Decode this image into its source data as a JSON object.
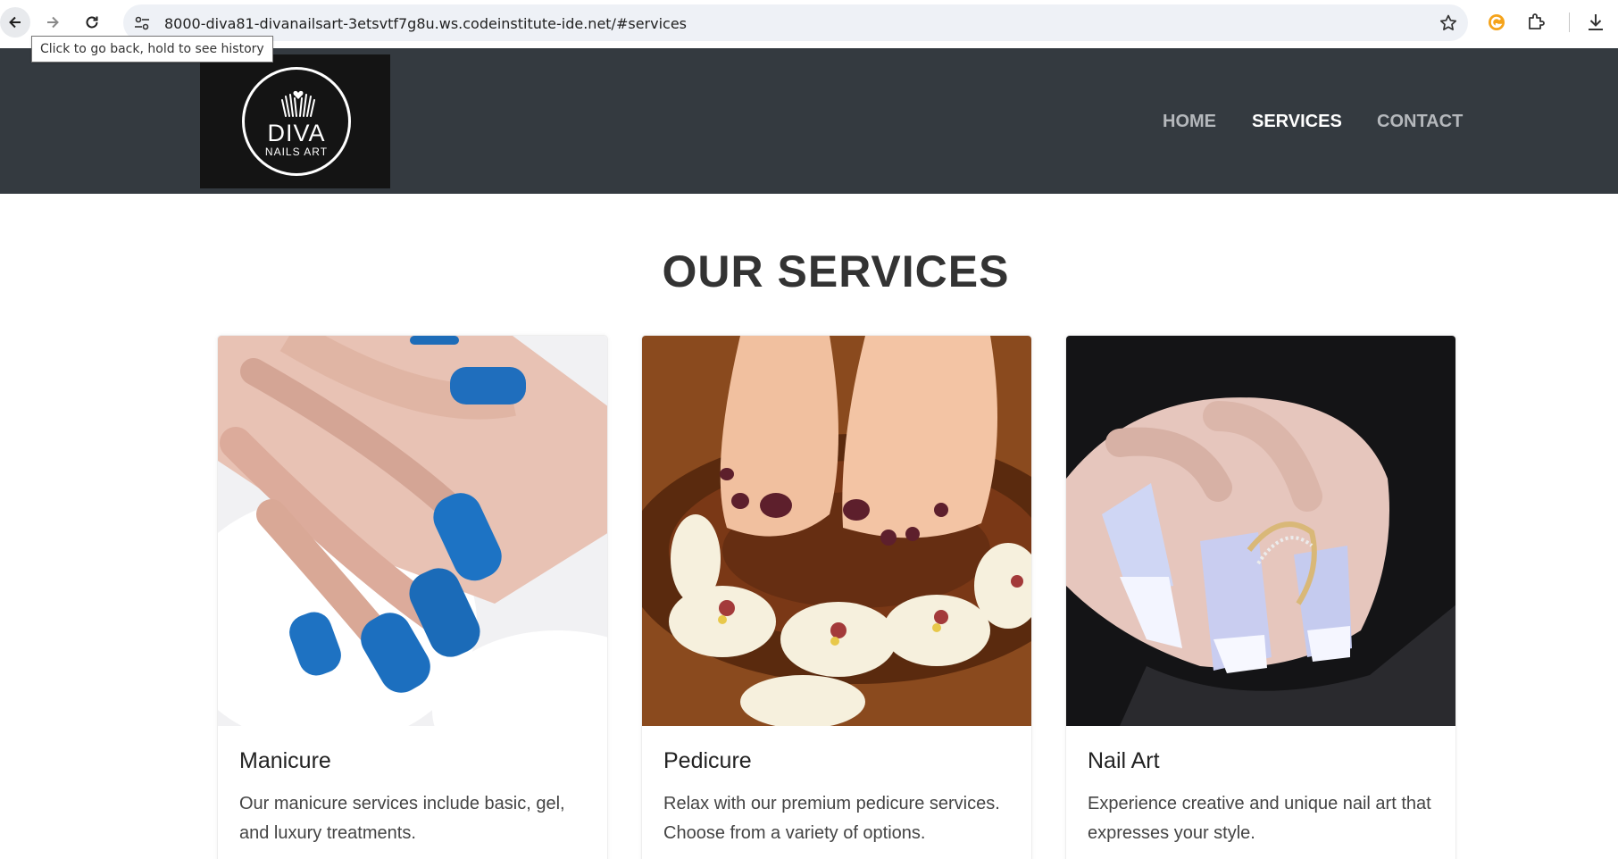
{
  "browser": {
    "url": "8000-diva81-divanailsart-3etsvtf7g8u.ws.codeinstitute-ide.net/#services",
    "tooltip": "Click to go back, hold to see history"
  },
  "header": {
    "logo": {
      "name": "DIVA",
      "tagline": "NAILS ART"
    },
    "nav": [
      {
        "label": "HOME",
        "active": false
      },
      {
        "label": "SERVICES",
        "active": true
      },
      {
        "label": "CONTACT",
        "active": false
      }
    ]
  },
  "services": {
    "title": "OUR SERVICES",
    "cards": [
      {
        "title": "Manicure",
        "text": "Our manicure services include basic, gel, and luxury treatments.",
        "image": "blue-manicure-photo"
      },
      {
        "title": "Pedicure",
        "text": "Relax with our premium pedicure services. Choose from a variety of options.",
        "image": "pedicure-orchids-photo"
      },
      {
        "title": "Nail Art",
        "text": "Experience creative and unique nail art that expresses your style.",
        "image": "french-nail-art-photo"
      }
    ]
  },
  "colors": {
    "header_bg": "#343a40",
    "logo_bg": "#141414",
    "nav_inactive": "#b5b8bc",
    "nav_active": "#ffffff"
  }
}
